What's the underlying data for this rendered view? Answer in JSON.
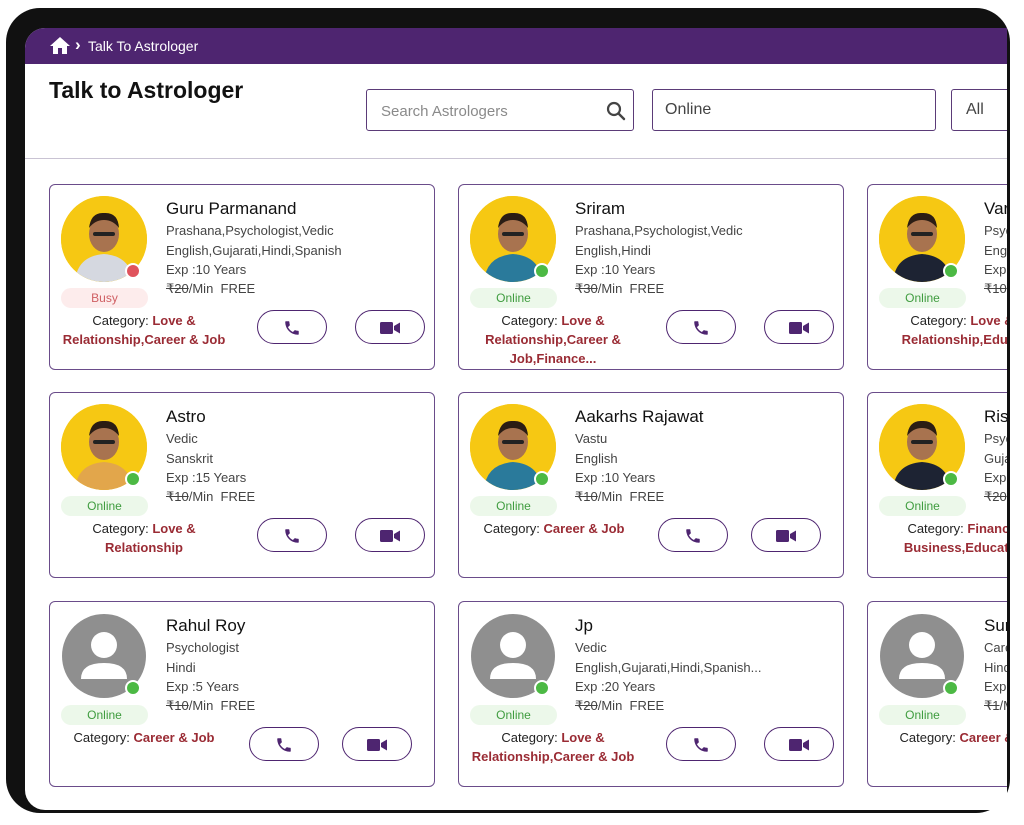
{
  "breadcrumb": {
    "current": "Talk To Astrologer"
  },
  "header": {
    "title": "Talk to Astrologer",
    "search_placeholder": "Search Astrologers",
    "status_filter": "Online",
    "category_filter": "All"
  },
  "colors": {
    "brand": "#4e2570",
    "online": "#4cb944",
    "busy": "#e0535d",
    "category_value": "#9a2b34",
    "avatar_bg": "#f6c813"
  },
  "astrologers": [
    {
      "name": "Guru Parmanand",
      "skills": "Prashana,Psychologist,Vedic",
      "languages": "English,Gujarati,Hindi,Spanish",
      "exp": "Exp :10 Years",
      "price_old": "₹20",
      "price_unit": "/Min",
      "price_free": "FREE",
      "status": "Busy",
      "category_label": "Category: ",
      "category_value": "Love & Relationship,Career & Job"
    },
    {
      "name": "Sriram",
      "skills": "Prashana,Psychologist,Vedic",
      "languages": "English,Hindi",
      "exp": "Exp :10 Years",
      "price_old": "₹30",
      "price_unit": "/Min",
      "price_free": "FREE",
      "status": "Online",
      "category_label": "Category: ",
      "category_value": "Love & Relationship,Career & Job,Finance..."
    },
    {
      "name": "Var",
      "skills": "Psyc",
      "languages": "Engl",
      "exp": "Exp",
      "price_old": "₹10",
      "price_unit": "",
      "price_free": "",
      "status": "Online",
      "category_label": "Category: ",
      "category_value": "Love & Relationship,Educa"
    },
    {
      "name": "Astro",
      "skills": "Vedic",
      "languages": "Sanskrit",
      "exp": "Exp :15 Years",
      "price_old": "₹10",
      "price_unit": "/Min",
      "price_free": "FREE",
      "status": "Online",
      "category_label": "Category: ",
      "category_value": "Love & Relationship"
    },
    {
      "name": "Aakarhs Rajawat",
      "skills": "Vastu",
      "languages": "English",
      "exp": "Exp :10 Years",
      "price_old": "₹10",
      "price_unit": "/Min",
      "price_free": "FREE",
      "status": "Online",
      "category_label": "Category: ",
      "category_value": "Career & Job"
    },
    {
      "name": "Risi",
      "skills": "Psyc",
      "languages": "Guja",
      "exp": "Exp",
      "price_old": "₹20",
      "price_unit": "",
      "price_free": "",
      "status": "Online",
      "category_label": "Category: ",
      "category_value": "Finance Business,Educatio"
    },
    {
      "name": "Rahul Roy",
      "skills": "Psychologist",
      "languages": "Hindi",
      "exp": "Exp :5 Years",
      "price_old": "₹10",
      "price_unit": "/Min",
      "price_free": "FREE",
      "status": "Online",
      "category_label": "Category: ",
      "category_value": "Career & Job"
    },
    {
      "name": "Jp",
      "skills": "Vedic",
      "languages": "English,Gujarati,Hindi,Spanish...",
      "exp": "Exp :20 Years",
      "price_old": "₹20",
      "price_unit": "/Min",
      "price_free": "FREE",
      "status": "Online",
      "category_label": "Category: ",
      "category_value": "Love & Relationship,Career & Job"
    },
    {
      "name": "Sur",
      "skills": "Care",
      "languages": "Hind",
      "exp": "Exp",
      "price_old": "₹1",
      "price_unit": "/M",
      "price_free": "",
      "status": "Online",
      "category_label": "Category: ",
      "category_value": "Career & J"
    }
  ]
}
